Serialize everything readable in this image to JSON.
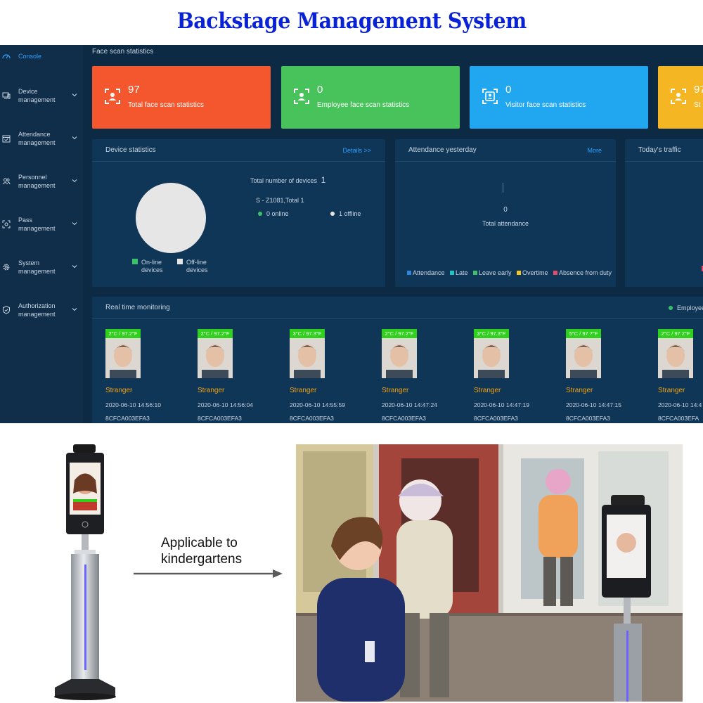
{
  "banner": {
    "title": "Backstage Management System"
  },
  "sidebar": {
    "items": [
      {
        "label": "Console",
        "icon": "dashboard-icon",
        "active": true
      },
      {
        "label": "Device management",
        "icon": "monitor-icon",
        "active": false
      },
      {
        "label": "Attendance management",
        "icon": "calendar-check-icon",
        "active": false
      },
      {
        "label": "Personnel management",
        "icon": "people-icon",
        "active": false
      },
      {
        "label": "Pass management",
        "icon": "face-scan-icon",
        "active": false
      },
      {
        "label": "System management",
        "icon": "gear-icon",
        "active": false
      },
      {
        "label": "Authorization management",
        "icon": "shield-check-icon",
        "active": false
      }
    ]
  },
  "dashboard": {
    "section_title": "Face scan statistics",
    "stat_cards": [
      {
        "value": "97",
        "label": "Total face scan statistics",
        "color": "#f4572e",
        "icon": "face-scan-icon"
      },
      {
        "value": "0",
        "label": "Employee face scan statistics",
        "color": "#48c25a",
        "icon": "person-badge-icon"
      },
      {
        "value": "0",
        "label": "Visitor face scan statistics",
        "color": "#21a6f0",
        "icon": "visitor-badge-icon"
      },
      {
        "value": "97",
        "label": "St",
        "color": "#f5b623",
        "icon": "face-scan-icon"
      }
    ],
    "device_stats": {
      "title": "Device statistics",
      "link": "Details >>",
      "total_label": "Total number of devices",
      "total_value": "1",
      "model_line": "S - Z1081,Total 1",
      "online_text": "0 online",
      "offline_text": "1 offline",
      "online": 0,
      "offline": 1,
      "legend_online": "On-line devices",
      "legend_offline": "Off-line devices",
      "online_color": "#3cc06a",
      "offline_color": "#e6e6e6"
    },
    "attendance": {
      "title": "Attendance yesterday",
      "link": "More",
      "value": "0",
      "label": "Total attendance",
      "legend": [
        {
          "label": "Attendance",
          "color": "#2e86de"
        },
        {
          "label": "Late",
          "color": "#1fc4c4"
        },
        {
          "label": "Leave early",
          "color": "#3cc06a"
        },
        {
          "label": "Overtime",
          "color": "#f5c623"
        },
        {
          "label": "Absence from duty",
          "color": "#e84a6a"
        }
      ]
    },
    "traffic": {
      "title": "Today's traffic"
    },
    "monitoring": {
      "title": "Real time monitoring",
      "legend": "Employee",
      "legend_color": "#3cc06a",
      "items": [
        {
          "temp": "2°C / 97.2°F",
          "name": "Stranger",
          "time": "2020-06-10 14:56:10",
          "id": "8CFCA003EFA3"
        },
        {
          "temp": "2°C / 97.2°F",
          "name": "Stranger",
          "time": "2020-06-10 14:56:04",
          "id": "8CFCA003EFA3"
        },
        {
          "temp": "3°C / 97.3°F",
          "name": "Stranger",
          "time": "2020-06-10 14:55:59",
          "id": "8CFCA003EFA3"
        },
        {
          "temp": "2°C / 97.2°F",
          "name": "Stranger",
          "time": "2020-06-10 14:47:24",
          "id": "8CFCA003EFA3"
        },
        {
          "temp": "3°C / 97.3°F",
          "name": "Stranger",
          "time": "2020-06-10 14:47:19",
          "id": "8CFCA003EFA3"
        },
        {
          "temp": "5°C / 97.7°F",
          "name": "Stranger",
          "time": "2020-06-10 14:47:15",
          "id": "8CFCA003EFA3"
        },
        {
          "temp": "2°C / 97.2°F",
          "name": "Stranger",
          "time": "2020-06-10 14:4",
          "id": "8CFCA003EFA"
        }
      ]
    }
  },
  "product": {
    "caption_line1": "Applicable to",
    "caption_line2": "kindergartens"
  }
}
